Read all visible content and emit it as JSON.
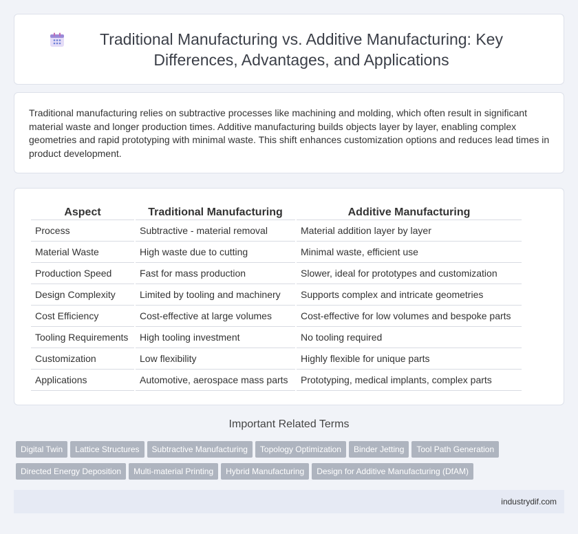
{
  "header": {
    "title": "Traditional Manufacturing vs. Additive Manufacturing: Key Differences, Advantages, and Applications",
    "icon": "calendar-icon"
  },
  "intro": {
    "text": "Traditional manufacturing relies on subtractive processes like machining and molding, which often result in significant material waste and longer production times. Additive manufacturing builds objects layer by layer, enabling complex geometries and rapid prototyping with minimal waste. This shift enhances customization options and reduces lead times in product development."
  },
  "table": {
    "headers": [
      "Aspect",
      "Traditional Manufacturing",
      "Additive Manufacturing"
    ],
    "rows": [
      [
        "Process",
        "Subtractive - material removal",
        "Material addition layer by layer"
      ],
      [
        "Material Waste",
        "High waste due to cutting",
        "Minimal waste, efficient use"
      ],
      [
        "Production Speed",
        "Fast for mass production",
        "Slower, ideal for prototypes and customization"
      ],
      [
        "Design Complexity",
        "Limited by tooling and machinery",
        "Supports complex and intricate geometries"
      ],
      [
        "Cost Efficiency",
        "Cost-effective at large volumes",
        "Cost-effective for low volumes and bespoke parts"
      ],
      [
        "Tooling Requirements",
        "High tooling investment",
        "No tooling required"
      ],
      [
        "Customization",
        "Low flexibility",
        "Highly flexible for unique parts"
      ],
      [
        "Applications",
        "Automotive, aerospace mass parts",
        "Prototyping, medical implants, complex parts"
      ]
    ]
  },
  "related": {
    "title": "Important Related Terms",
    "tags": [
      "Digital Twin",
      "Lattice Structures",
      "Subtractive Manufacturing",
      "Topology Optimization",
      "Binder Jetting",
      "Tool Path Generation",
      "Directed Energy Deposition",
      "Multi-material Printing",
      "Hybrid Manufacturing",
      "Design for Additive Manufacturing (DfAM)"
    ]
  },
  "footer": {
    "site": "industrydif.com"
  },
  "colors": {
    "tag_bg": "#aeb4bf",
    "page_bg": "#f1f3f8",
    "footer_bg": "#e6eaf4"
  }
}
